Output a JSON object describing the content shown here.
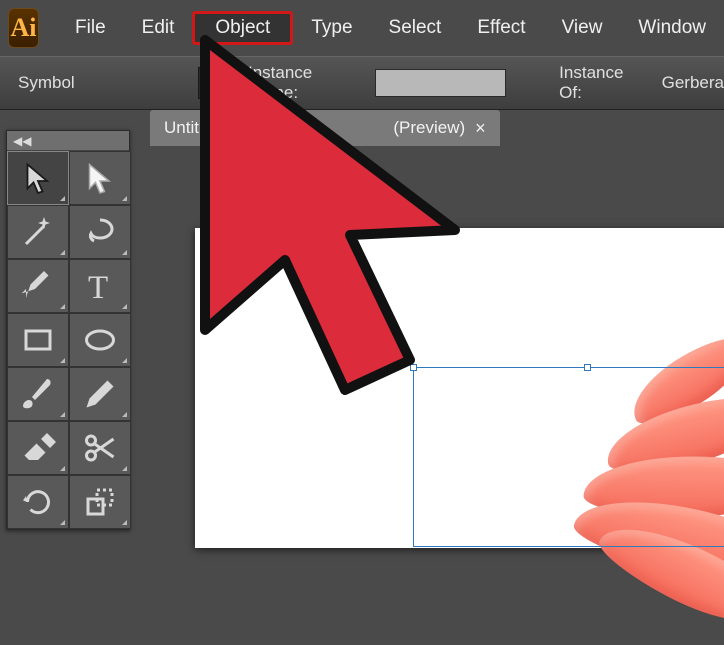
{
  "app": {
    "abbr": "Ai"
  },
  "menu": {
    "items": [
      {
        "label": "File"
      },
      {
        "label": "Edit"
      },
      {
        "label": "Object",
        "highlighted": true
      },
      {
        "label": "Type"
      },
      {
        "label": "Select"
      },
      {
        "label": "Effect"
      },
      {
        "label": "View"
      },
      {
        "label": "Window"
      }
    ]
  },
  "controlbar": {
    "symbol_label": "Symbol",
    "instance_name_label": "Instance Name:",
    "instance_of_label": "Instance Of:",
    "instance_of_value": "Gerbera"
  },
  "tab": {
    "filename": "Untitled-7*",
    "view_suffix": "(Preview)",
    "close_glyph": "×"
  },
  "tool_panel": {
    "collapse_glyph": "◀◀"
  },
  "tools": [
    {
      "name": "selection-tool",
      "icon": "cursor-black",
      "selected": true
    },
    {
      "name": "direct-selection-tool",
      "icon": "cursor-white"
    },
    {
      "name": "magic-wand-tool",
      "icon": "wand"
    },
    {
      "name": "lasso-tool",
      "icon": "lasso"
    },
    {
      "name": "pen-tool",
      "icon": "pen"
    },
    {
      "name": "type-tool",
      "icon": "type"
    },
    {
      "name": "rectangle-tool",
      "icon": "rect"
    },
    {
      "name": "ellipse-tool",
      "icon": "ellipse"
    },
    {
      "name": "paintbrush-tool",
      "icon": "brush"
    },
    {
      "name": "pencil-tool",
      "icon": "pencil"
    },
    {
      "name": "eraser-tool",
      "icon": "eraser"
    },
    {
      "name": "scissors-tool",
      "icon": "scissors"
    },
    {
      "name": "rotate-tool",
      "icon": "rotate"
    },
    {
      "name": "scale-tool",
      "icon": "scale"
    }
  ]
}
